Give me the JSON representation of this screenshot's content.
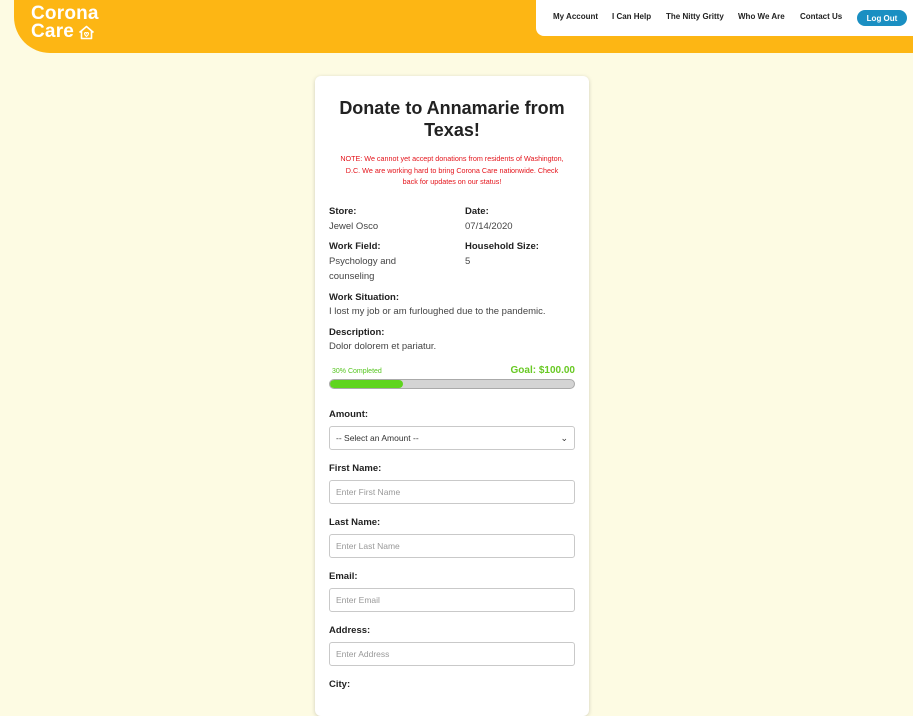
{
  "brand": {
    "line1": "Corona",
    "line2": "Care"
  },
  "nav": {
    "items": [
      "My Account",
      "I Can Help",
      "The Nitty Gritty",
      "Who We Are",
      "Contact Us"
    ],
    "logout": "Log Out"
  },
  "card": {
    "title": "Donate to Annamarie from Texas!",
    "note": "NOTE: We cannot yet accept donations from residents of Washington, D.C. We are working hard to bring Corona Care nationwide. Check back for updates on our status!",
    "store_label": "Store:",
    "store_value": "Jewel Osco",
    "date_label": "Date:",
    "date_value": "07/14/2020",
    "work_field_label": "Work Field:",
    "work_field_value": "Psychology and counseling",
    "household_label": "Household Size:",
    "household_value": "5",
    "situation_label": "Work Situation:",
    "situation_value": "I lost my job or am furloughed due to the pandemic.",
    "description_label": "Description:",
    "description_value": "Dolor dolorem et pariatur.",
    "progress_text": "30% Completed",
    "progress_fraction": 0.3,
    "goal_text": "Goal: $100.00"
  },
  "form": {
    "amount_label": "Amount:",
    "amount_selected": "-- Select an Amount --",
    "first_name_label": "First Name:",
    "first_name_placeholder": "Enter First Name",
    "last_name_label": "Last Name:",
    "last_name_placeholder": "Enter Last Name",
    "email_label": "Email:",
    "email_placeholder": "Enter Email",
    "address_label": "Address:",
    "address_placeholder": "Enter Address",
    "city_label": "City:"
  },
  "colors": {
    "brand": "#fdb614",
    "background": "#fdfbe3",
    "accent_blue": "#1a8fc2",
    "warning": "#e4141b",
    "progress": "#5fd51e"
  }
}
